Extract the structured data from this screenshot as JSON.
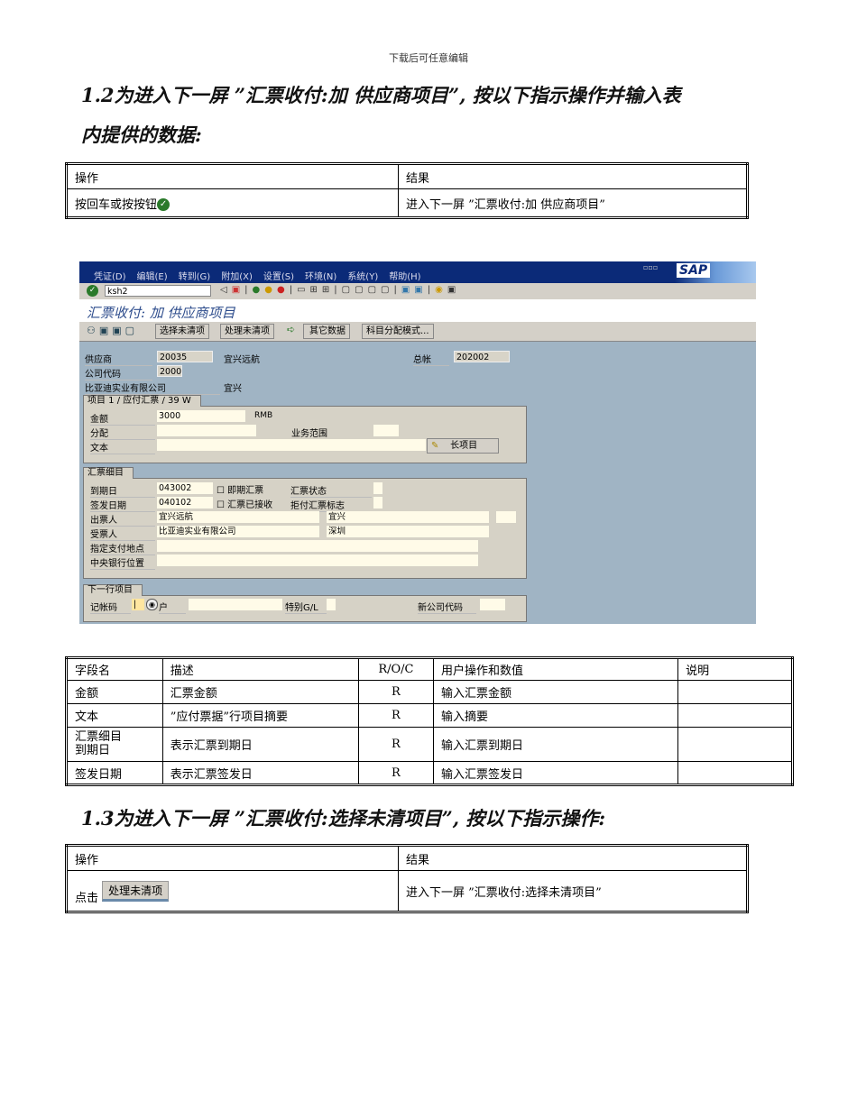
{
  "header": "下载后可任意编辑",
  "s12": {
    "title_line1": "1.2为进入下一屏 ”汇票收付:加 供应商项目”, 按以下指示操作并输入表",
    "title_line2": "内提供的数据:",
    "table": {
      "h_op": "操作",
      "h_res": "结果",
      "op": "按回车或按按钮",
      "res": "进入下一屏 ”汇票收付:加 供应商项目”"
    }
  },
  "sap": {
    "menu": [
      "凭证(D)",
      "编辑(E)",
      "转到(G)",
      "附加(X)",
      "设置(S)",
      "环境(N)",
      "系统(Y)",
      "帮助(H)"
    ],
    "command": "ksh2",
    "logo": "SAP",
    "screen_title": "汇票收付: 加 供应商项目",
    "app_buttons": [
      "选择未清项",
      "处理未清项",
      "其它数据",
      "科目分配模式..."
    ],
    "vendor_label": "供应商",
    "vendor": "20035",
    "vendor_name": "宜兴远航",
    "gl_label": "总帐",
    "gl": "202002",
    "company_label": "公司代码",
    "company": "2000",
    "company_name": "比亚迪实业有限公司",
    "city": "宜兴",
    "group1_title": "项目 1 / 应付汇票 / 39 W",
    "amount_label": "金额",
    "amount": "3000",
    "currency": "RMB",
    "assign_label": "分配",
    "bus_area_label": "业务范围",
    "text_label": "文本",
    "long_item": "长项目",
    "group2_title": "汇票细目",
    "due_label": "到期日",
    "due": "043002",
    "demand_label": "即期汇票",
    "status_label": "汇票状态",
    "issue_label": "签发日期",
    "issue": "040102",
    "accepted_label": "汇票已接收",
    "protest_label": "拒付汇票标志",
    "drawer_label": "出票人",
    "drawer": "宜兴远航",
    "drawer_city": "宜兴",
    "payee_label": "受票人",
    "payee": "比亚迪实业有限公司",
    "payee_city": "深圳",
    "payplace_label": "指定支付地点",
    "cb_label": "中央银行位置",
    "group3_title": "下一行项目",
    "postkey_label": "记帐码",
    "account_label": "户",
    "special_label": "特别G/L",
    "newco_label": "新公司代码"
  },
  "fields": {
    "headers": [
      "字段名",
      "描述",
      "R/O/C",
      "用户操作和数值",
      "说明"
    ],
    "rows": [
      [
        "金额",
        "汇票金额",
        "R",
        "输入汇票金额",
        ""
      ],
      [
        "文本",
        "”应付票据”行项目摘要",
        "R",
        "输入摘要",
        ""
      ],
      [
        "汇票细目\n到期日",
        "表示汇票到期日",
        "R",
        "输入汇票到期日",
        ""
      ],
      [
        "签发日期",
        "表示汇票签发日",
        "R",
        "输入汇票签发日",
        ""
      ]
    ]
  },
  "s13": {
    "title": "1.3为进入下一屏 ”汇票收付:选择未清项目”, 按以下指示操作:",
    "table": {
      "h_op": "操作",
      "h_res": "结果",
      "op": "点击",
      "button": "处理未清项",
      "res": "进入下一屏 ”汇票收付:选择未清项目”"
    }
  }
}
